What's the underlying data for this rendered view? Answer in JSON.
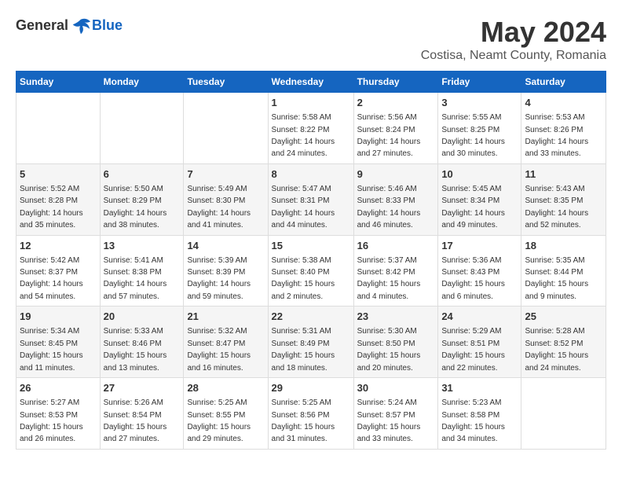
{
  "app": {
    "logo_general": "General",
    "logo_blue": "Blue"
  },
  "title": "May 2024",
  "subtitle": "Costisa, Neamt County, Romania",
  "days_of_week": [
    "Sunday",
    "Monday",
    "Tuesday",
    "Wednesday",
    "Thursday",
    "Friday",
    "Saturday"
  ],
  "weeks": [
    {
      "cells": [
        {
          "day": "",
          "sunrise": "",
          "sunset": "",
          "daylight": ""
        },
        {
          "day": "",
          "sunrise": "",
          "sunset": "",
          "daylight": ""
        },
        {
          "day": "",
          "sunrise": "",
          "sunset": "",
          "daylight": ""
        },
        {
          "day": "1",
          "sunrise": "Sunrise: 5:58 AM",
          "sunset": "Sunset: 8:22 PM",
          "daylight": "Daylight: 14 hours and 24 minutes."
        },
        {
          "day": "2",
          "sunrise": "Sunrise: 5:56 AM",
          "sunset": "Sunset: 8:24 PM",
          "daylight": "Daylight: 14 hours and 27 minutes."
        },
        {
          "day": "3",
          "sunrise": "Sunrise: 5:55 AM",
          "sunset": "Sunset: 8:25 PM",
          "daylight": "Daylight: 14 hours and 30 minutes."
        },
        {
          "day": "4",
          "sunrise": "Sunrise: 5:53 AM",
          "sunset": "Sunset: 8:26 PM",
          "daylight": "Daylight: 14 hours and 33 minutes."
        }
      ]
    },
    {
      "cells": [
        {
          "day": "5",
          "sunrise": "Sunrise: 5:52 AM",
          "sunset": "Sunset: 8:28 PM",
          "daylight": "Daylight: 14 hours and 35 minutes."
        },
        {
          "day": "6",
          "sunrise": "Sunrise: 5:50 AM",
          "sunset": "Sunset: 8:29 PM",
          "daylight": "Daylight: 14 hours and 38 minutes."
        },
        {
          "day": "7",
          "sunrise": "Sunrise: 5:49 AM",
          "sunset": "Sunset: 8:30 PM",
          "daylight": "Daylight: 14 hours and 41 minutes."
        },
        {
          "day": "8",
          "sunrise": "Sunrise: 5:47 AM",
          "sunset": "Sunset: 8:31 PM",
          "daylight": "Daylight: 14 hours and 44 minutes."
        },
        {
          "day": "9",
          "sunrise": "Sunrise: 5:46 AM",
          "sunset": "Sunset: 8:33 PM",
          "daylight": "Daylight: 14 hours and 46 minutes."
        },
        {
          "day": "10",
          "sunrise": "Sunrise: 5:45 AM",
          "sunset": "Sunset: 8:34 PM",
          "daylight": "Daylight: 14 hours and 49 minutes."
        },
        {
          "day": "11",
          "sunrise": "Sunrise: 5:43 AM",
          "sunset": "Sunset: 8:35 PM",
          "daylight": "Daylight: 14 hours and 52 minutes."
        }
      ]
    },
    {
      "cells": [
        {
          "day": "12",
          "sunrise": "Sunrise: 5:42 AM",
          "sunset": "Sunset: 8:37 PM",
          "daylight": "Daylight: 14 hours and 54 minutes."
        },
        {
          "day": "13",
          "sunrise": "Sunrise: 5:41 AM",
          "sunset": "Sunset: 8:38 PM",
          "daylight": "Daylight: 14 hours and 57 minutes."
        },
        {
          "day": "14",
          "sunrise": "Sunrise: 5:39 AM",
          "sunset": "Sunset: 8:39 PM",
          "daylight": "Daylight: 14 hours and 59 minutes."
        },
        {
          "day": "15",
          "sunrise": "Sunrise: 5:38 AM",
          "sunset": "Sunset: 8:40 PM",
          "daylight": "Daylight: 15 hours and 2 minutes."
        },
        {
          "day": "16",
          "sunrise": "Sunrise: 5:37 AM",
          "sunset": "Sunset: 8:42 PM",
          "daylight": "Daylight: 15 hours and 4 minutes."
        },
        {
          "day": "17",
          "sunrise": "Sunrise: 5:36 AM",
          "sunset": "Sunset: 8:43 PM",
          "daylight": "Daylight: 15 hours and 6 minutes."
        },
        {
          "day": "18",
          "sunrise": "Sunrise: 5:35 AM",
          "sunset": "Sunset: 8:44 PM",
          "daylight": "Daylight: 15 hours and 9 minutes."
        }
      ]
    },
    {
      "cells": [
        {
          "day": "19",
          "sunrise": "Sunrise: 5:34 AM",
          "sunset": "Sunset: 8:45 PM",
          "daylight": "Daylight: 15 hours and 11 minutes."
        },
        {
          "day": "20",
          "sunrise": "Sunrise: 5:33 AM",
          "sunset": "Sunset: 8:46 PM",
          "daylight": "Daylight: 15 hours and 13 minutes."
        },
        {
          "day": "21",
          "sunrise": "Sunrise: 5:32 AM",
          "sunset": "Sunset: 8:47 PM",
          "daylight": "Daylight: 15 hours and 16 minutes."
        },
        {
          "day": "22",
          "sunrise": "Sunrise: 5:31 AM",
          "sunset": "Sunset: 8:49 PM",
          "daylight": "Daylight: 15 hours and 18 minutes."
        },
        {
          "day": "23",
          "sunrise": "Sunrise: 5:30 AM",
          "sunset": "Sunset: 8:50 PM",
          "daylight": "Daylight: 15 hours and 20 minutes."
        },
        {
          "day": "24",
          "sunrise": "Sunrise: 5:29 AM",
          "sunset": "Sunset: 8:51 PM",
          "daylight": "Daylight: 15 hours and 22 minutes."
        },
        {
          "day": "25",
          "sunrise": "Sunrise: 5:28 AM",
          "sunset": "Sunset: 8:52 PM",
          "daylight": "Daylight: 15 hours and 24 minutes."
        }
      ]
    },
    {
      "cells": [
        {
          "day": "26",
          "sunrise": "Sunrise: 5:27 AM",
          "sunset": "Sunset: 8:53 PM",
          "daylight": "Daylight: 15 hours and 26 minutes."
        },
        {
          "day": "27",
          "sunrise": "Sunrise: 5:26 AM",
          "sunset": "Sunset: 8:54 PM",
          "daylight": "Daylight: 15 hours and 27 minutes."
        },
        {
          "day": "28",
          "sunrise": "Sunrise: 5:25 AM",
          "sunset": "Sunset: 8:55 PM",
          "daylight": "Daylight: 15 hours and 29 minutes."
        },
        {
          "day": "29",
          "sunrise": "Sunrise: 5:25 AM",
          "sunset": "Sunset: 8:56 PM",
          "daylight": "Daylight: 15 hours and 31 minutes."
        },
        {
          "day": "30",
          "sunrise": "Sunrise: 5:24 AM",
          "sunset": "Sunset: 8:57 PM",
          "daylight": "Daylight: 15 hours and 33 minutes."
        },
        {
          "day": "31",
          "sunrise": "Sunrise: 5:23 AM",
          "sunset": "Sunset: 8:58 PM",
          "daylight": "Daylight: 15 hours and 34 minutes."
        },
        {
          "day": "",
          "sunrise": "",
          "sunset": "",
          "daylight": ""
        }
      ]
    }
  ]
}
